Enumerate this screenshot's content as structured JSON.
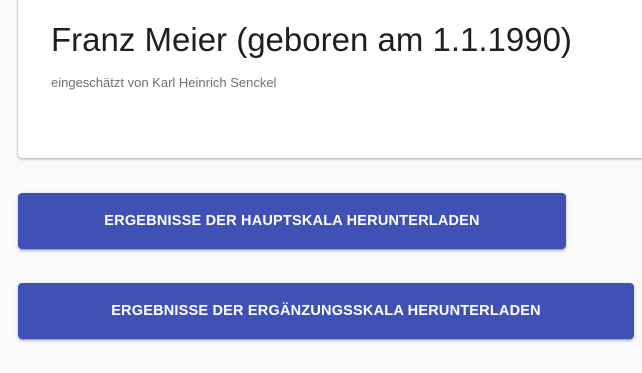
{
  "profile": {
    "title": "Franz Meier (geboren am 1.1.1990)",
    "assessed_by": "eingeschätzt von Karl Heinrich Senckel"
  },
  "actions": {
    "download_main_scale": "ERGEBNISSE DER HAUPTSKALA HERUNTERLADEN",
    "download_supplementary_scale": "ERGEBNISSE DER ERGÄNZUNGSSKALA HERUNTERLADEN"
  },
  "colors": {
    "primary": "#3f51b5",
    "background": "#fafafa",
    "card": "#ffffff"
  }
}
